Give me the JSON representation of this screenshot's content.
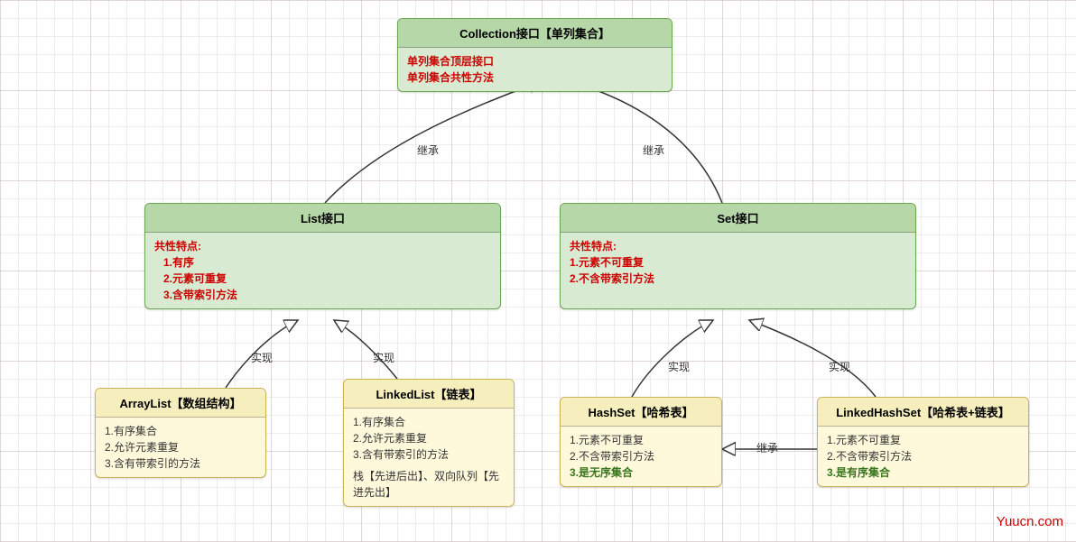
{
  "chart_data": {
    "type": "diagram",
    "title": "Java Collection 单列集合继承体系",
    "nodes": [
      {
        "id": "collection",
        "type": "interface",
        "title": "Collection接口【单列集合】",
        "body": [
          "单列集合顶层接口",
          "单列集合共性方法"
        ]
      },
      {
        "id": "list",
        "type": "interface",
        "title": "List接口",
        "body_header": "共性特点:",
        "body": [
          "1.有序",
          "2.元素可重复",
          "3.含带索引方法"
        ]
      },
      {
        "id": "set",
        "type": "interface",
        "title": "Set接口",
        "body_header": "共性特点:",
        "body": [
          "1.元素不可重复",
          "2.不含带索引方法"
        ]
      },
      {
        "id": "arraylist",
        "type": "class",
        "title": "ArrayList【数组结构】",
        "body": [
          "1.有序集合",
          "2.允许元素重复",
          "3.含有带索引的方法"
        ]
      },
      {
        "id": "linkedlist",
        "type": "class",
        "title": "LinkedList【链表】",
        "body": [
          "1.有序集合",
          "2.允许元素重复",
          "3.含有带索引的方法"
        ],
        "note": "栈【先进后出】、双向队列【先进先出】"
      },
      {
        "id": "hashset",
        "type": "class",
        "title": "HashSet【哈希表】",
        "body": [
          "1.元素不可重复",
          "2.不含带索引方法"
        ],
        "extra": "3.是无序集合"
      },
      {
        "id": "linkedhashset",
        "type": "class",
        "title": "LinkedHashSet【哈希表+链表】",
        "body": [
          "1.元素不可重复",
          "2.不含带索引方法"
        ],
        "extra": "3.是有序集合"
      }
    ],
    "edges": [
      {
        "from": "list",
        "to": "collection",
        "label": "继承"
      },
      {
        "from": "set",
        "to": "collection",
        "label": "继承"
      },
      {
        "from": "arraylist",
        "to": "list",
        "label": "实现"
      },
      {
        "from": "linkedlist",
        "to": "list",
        "label": "实现"
      },
      {
        "from": "hashset",
        "to": "set",
        "label": "实现"
      },
      {
        "from": "linkedhashset",
        "to": "set",
        "label": "实现"
      },
      {
        "from": "linkedhashset",
        "to": "hashset",
        "label": "继承"
      }
    ],
    "watermark": "Yuucn.com"
  },
  "nodes": {
    "collection": {
      "title": "Collection接口【单列集合】",
      "l1": "单列集合顶层接口",
      "l2": "单列集合共性方法"
    },
    "list": {
      "title": "List接口",
      "hdr": "共性特点:",
      "l1": "1.有序",
      "l2": "2.元素可重复",
      "l3": "3.含带索引方法"
    },
    "set": {
      "title": "Set接口",
      "hdr": "共性特点:",
      "l1": "1.元素不可重复",
      "l2": "2.不含带索引方法"
    },
    "arraylist": {
      "title": "ArrayList【数组结构】",
      "l1": "1.有序集合",
      "l2": "2.允许元素重复",
      "l3": "3.含有带索引的方法"
    },
    "linkedlist": {
      "title": "LinkedList【链表】",
      "l1": "1.有序集合",
      "l2": "2.允许元素重复",
      "l3": "3.含有带索引的方法",
      "note": "栈【先进后出】、双向队列【先进先出】"
    },
    "hashset": {
      "title": "HashSet【哈希表】",
      "l1": "1.元素不可重复",
      "l2": "2.不含带索引方法",
      "l3": "3.是无序集合"
    },
    "linkedhashset": {
      "title": "LinkedHashSet【哈希表+链表】",
      "l1": "1.元素不可重复",
      "l2": "2.不含带索引方法",
      "l3": "3.是有序集合"
    }
  },
  "labels": {
    "inherit": "继承",
    "implement": "实现"
  },
  "watermark": "Yuucn.com"
}
